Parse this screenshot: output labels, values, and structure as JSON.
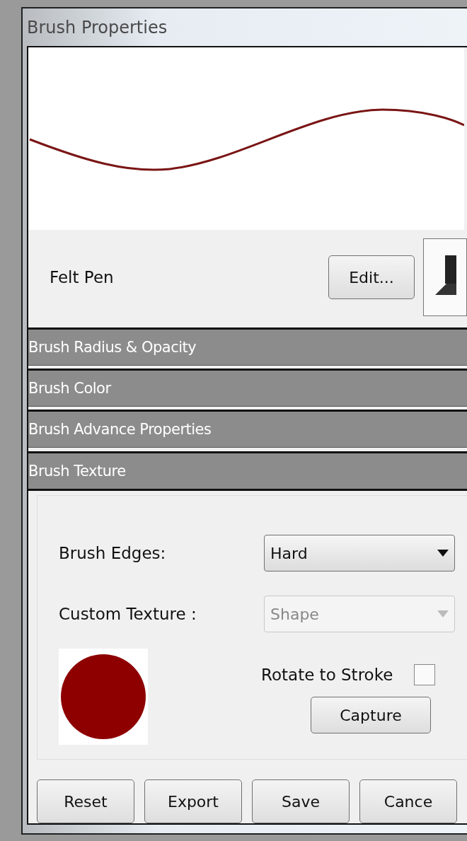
{
  "window": {
    "title": "Brush Properties"
  },
  "brush": {
    "name": "Felt Pen",
    "edit_button": "Edit..."
  },
  "sections": [
    {
      "title": "Brush Radius & Opacity",
      "expanded": false
    },
    {
      "title": "Brush Color",
      "expanded": false
    },
    {
      "title": "Brush Advance Properties",
      "expanded": false
    },
    {
      "title": "Brush Texture",
      "expanded": true
    }
  ],
  "texture": {
    "fields": [
      {
        "label": "Brush Edges:",
        "value": "Hard",
        "disabled": false
      },
      {
        "label": "Custom Texture :",
        "value": "Shape",
        "disabled": true
      }
    ],
    "rotate_to_stroke": {
      "label": "Rotate to Stroke",
      "checked": false
    },
    "capture_button": "Capture"
  },
  "buttons": [
    "Reset",
    "Export",
    "Save",
    "Cance"
  ]
}
